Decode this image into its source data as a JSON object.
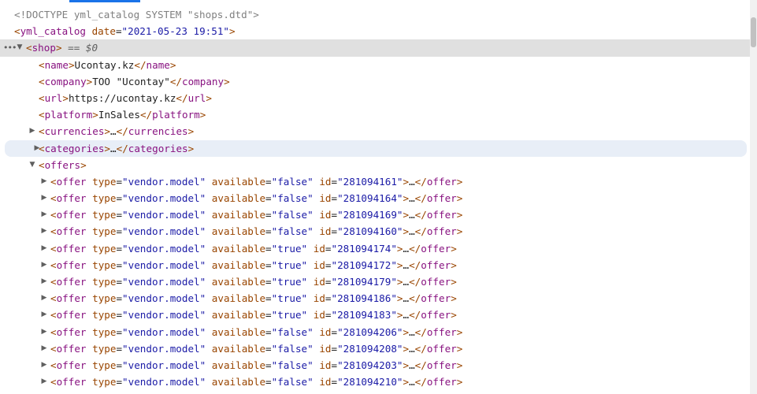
{
  "doctype_line": "<!DOCTYPE yml_catalog SYSTEM \"shops.dtd\">",
  "root": {
    "tag": "yml_catalog",
    "attr_name": "date",
    "attr_value": "\"2021-05-23 19:51\""
  },
  "shop": {
    "tag": "shop",
    "selected_ref": "== $0",
    "more_glyph": "•••",
    "expanded_glyph": "▼",
    "collapsed_glyph": "▶"
  },
  "children": [
    {
      "tag": "name",
      "text": "Ucontay.kz"
    },
    {
      "tag": "company",
      "text": "ТОО \"Ucontay\""
    },
    {
      "tag": "url",
      "text": "https://ucontay.kz"
    },
    {
      "tag": "platform",
      "text": "InSales"
    }
  ],
  "collapsed_children": [
    {
      "tag": "currencies",
      "ellipsis": "…"
    },
    {
      "tag": "categories",
      "ellipsis": "…"
    }
  ],
  "offers_tag": "offers",
  "offer_tag": "offer",
  "offer_attr_names": {
    "type": "type",
    "available": "available",
    "id": "id"
  },
  "offers": [
    {
      "type": "\"vendor.model\"",
      "available": "\"false\"",
      "id": "\"281094161\""
    },
    {
      "type": "\"vendor.model\"",
      "available": "\"false\"",
      "id": "\"281094164\""
    },
    {
      "type": "\"vendor.model\"",
      "available": "\"false\"",
      "id": "\"281094169\""
    },
    {
      "type": "\"vendor.model\"",
      "available": "\"false\"",
      "id": "\"281094160\""
    },
    {
      "type": "\"vendor.model\"",
      "available": "\"true\"",
      "id": "\"281094174\""
    },
    {
      "type": "\"vendor.model\"",
      "available": "\"true\"",
      "id": "\"281094172\""
    },
    {
      "type": "\"vendor.model\"",
      "available": "\"true\"",
      "id": "\"281094179\""
    },
    {
      "type": "\"vendor.model\"",
      "available": "\"true\"",
      "id": "\"281094186\""
    },
    {
      "type": "\"vendor.model\"",
      "available": "\"true\"",
      "id": "\"281094183\""
    },
    {
      "type": "\"vendor.model\"",
      "available": "\"false\"",
      "id": "\"281094206\""
    },
    {
      "type": "\"vendor.model\"",
      "available": "\"false\"",
      "id": "\"281094208\""
    },
    {
      "type": "\"vendor.model\"",
      "available": "\"false\"",
      "id": "\"281094203\""
    },
    {
      "type": "\"vendor.model\"",
      "available": "\"false\"",
      "id": "\"281094210\""
    }
  ],
  "offer_ellipsis": "…"
}
